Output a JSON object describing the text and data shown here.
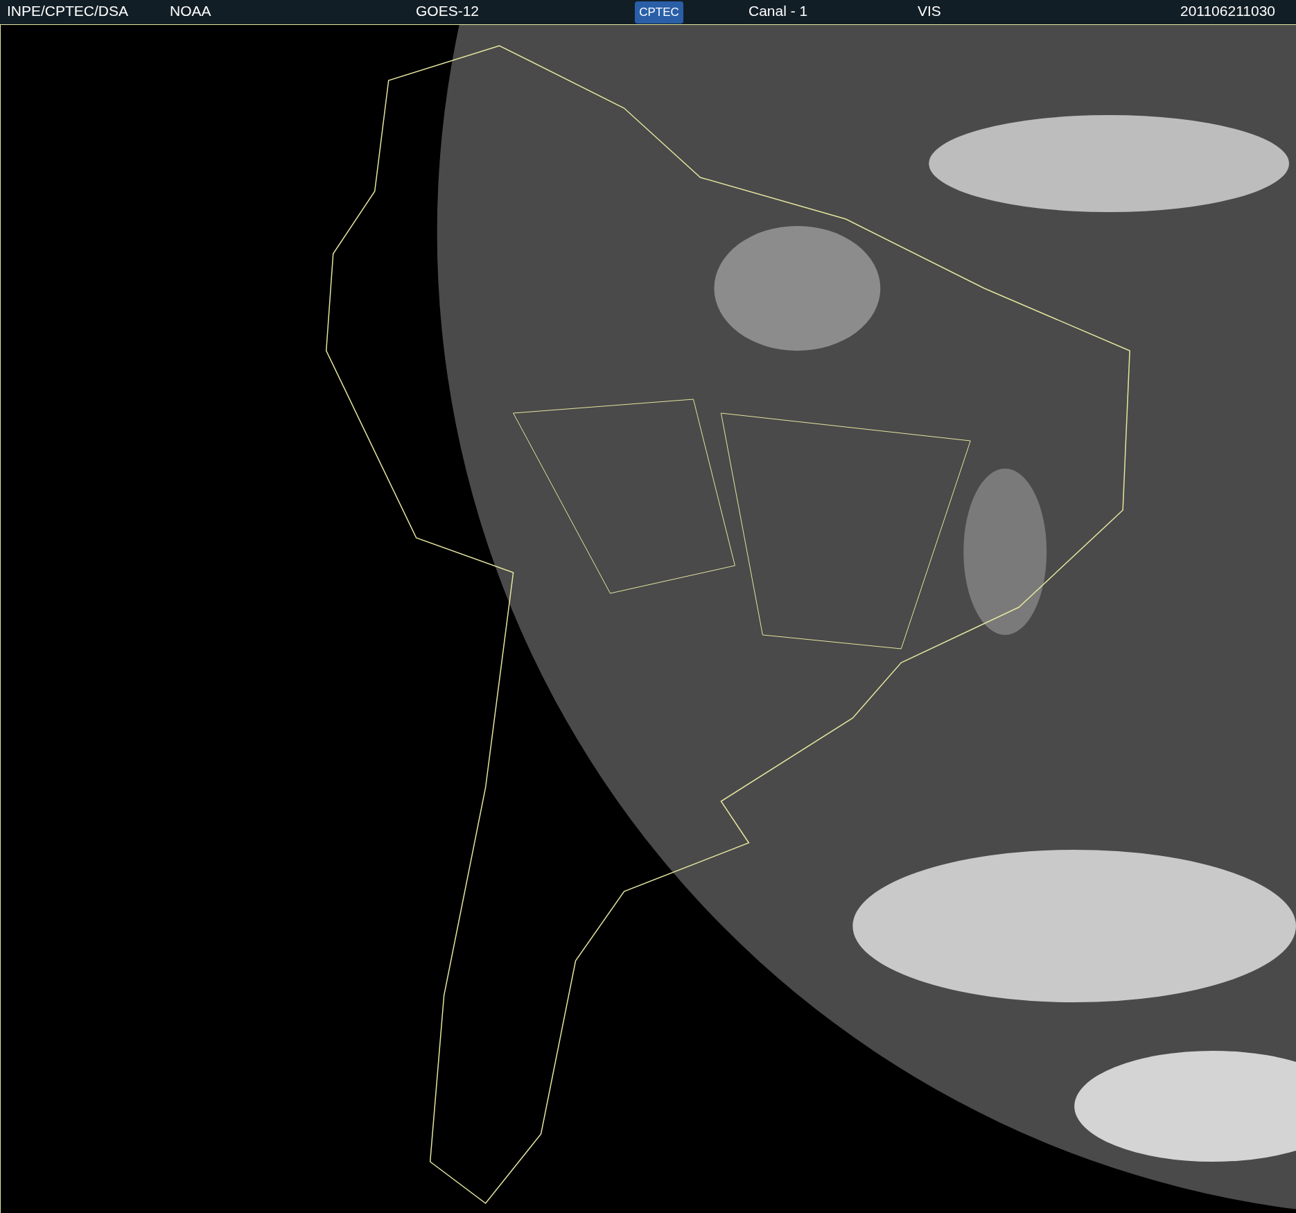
{
  "header": {
    "source": "INPE/CPTEC/DSA",
    "agency": "NOAA",
    "satellite": "GOES-12",
    "logo": "CPTEC",
    "channel": "Canal - 1",
    "band": "VIS",
    "timestamp": "201106211030"
  }
}
